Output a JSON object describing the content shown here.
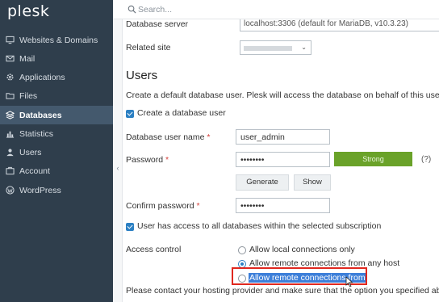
{
  "sidebar": {
    "logo": "plesk",
    "items": [
      {
        "label": "Websites & Domains",
        "icon": "monitor-icon"
      },
      {
        "label": "Mail",
        "icon": "mail-icon"
      },
      {
        "label": "Applications",
        "icon": "gear-icon"
      },
      {
        "label": "Files",
        "icon": "folder-icon"
      },
      {
        "label": "Databases",
        "icon": "database-icon",
        "active": true
      },
      {
        "label": "Statistics",
        "icon": "bar-chart-icon"
      },
      {
        "label": "Users",
        "icon": "user-icon"
      },
      {
        "label": "Account",
        "icon": "account-icon"
      },
      {
        "label": "WordPress",
        "icon": "wordpress-icon"
      }
    ]
  },
  "search": {
    "placeholder": "Search..."
  },
  "form": {
    "database_server_label": "Database server",
    "database_server_value": "localhost:3306 (default for MariaDB, v10.3.23)",
    "related_site_label": "Related site",
    "users_title": "Users",
    "users_description": "Create a default database user. Plesk will access the database on behalf of this user. If no da",
    "create_user_label": "Create a database user",
    "username_label": "Database user name",
    "username_value": "user_admin",
    "password_label": "Password",
    "password_value": "••••••••",
    "strength_label": "Strong",
    "help_label": "(?)",
    "generate_label": "Generate",
    "show_label": "Show",
    "confirm_label": "Confirm password",
    "confirm_value": "••••••••",
    "access_all_label": "User has access to all databases within the selected subscription",
    "access_control_label": "Access control",
    "access_options": [
      "Allow local connections only",
      "Allow remote connections from any host",
      "Allow remote connections from"
    ],
    "footer_note": "Please contact your hosting provider and make sure that the option you specified above will"
  },
  "colors": {
    "sidebar_bg": "#2f3e4c",
    "active_item_bg": "#44596d",
    "accent": "#2c80c3",
    "strength_strong": "#6aa229",
    "highlight_border": "#e0281f"
  }
}
